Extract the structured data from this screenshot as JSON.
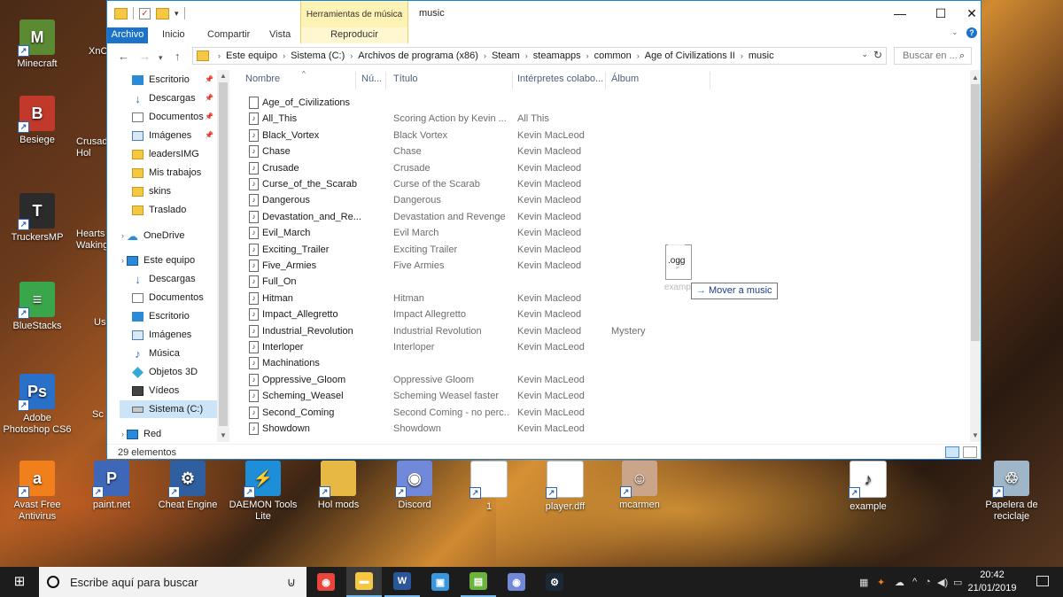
{
  "desktop": {
    "icons": [
      {
        "label": "Minecraft",
        "color": "#5b8a32",
        "glyph": "M"
      },
      {
        "label": "Besiege",
        "color": "#c0392b",
        "glyph": "B"
      },
      {
        "label": "TruckersMP",
        "color": "#2b2b2b",
        "glyph": "T"
      },
      {
        "label": "BlueStacks",
        "color": "#3aa64c",
        "glyph": "≡"
      },
      {
        "label": "Adobe Photoshop CS6",
        "color": "#2a6fc8",
        "glyph": "Ps"
      },
      {
        "label": "Avast Free Antivirus",
        "color": "#f07f1c",
        "glyph": "a"
      },
      {
        "label": "paint.net",
        "color": "#3e67b8",
        "glyph": "P"
      },
      {
        "label": "Cheat Engine",
        "color": "#2f5f9e",
        "glyph": "⚙"
      },
      {
        "label": "DAEMON Tools Lite",
        "color": "#1e8ed8",
        "glyph": "⚡"
      },
      {
        "label": "Hol mods",
        "color": "#e8b845",
        "glyph": ""
      },
      {
        "label": "Discord",
        "color": "#7289da",
        "glyph": "◉"
      },
      {
        "label": "1",
        "color": "#ffffff",
        "glyph": ""
      },
      {
        "label": "player.dff",
        "color": "#ffffff",
        "glyph": ""
      },
      {
        "label": "mcarmen",
        "color": "#caa58a",
        "glyph": "☺"
      },
      {
        "label": "example",
        "color": "#ffffff",
        "glyph": "♪"
      },
      {
        "label": "Papelera de reciclaje",
        "color": "#9fb5c8",
        "glyph": "♲"
      }
    ],
    "partial_labels": [
      "XnC",
      "Crusad Hol",
      "Hearts Waking",
      "Us",
      "Sc"
    ]
  },
  "window": {
    "title": "music",
    "context_tab_group": "Herramientas de música",
    "ribbon_tabs": [
      "Archivo",
      "Inicio",
      "Compartir",
      "Vista",
      "Reproducir"
    ],
    "accent_color": "#1a73c8"
  },
  "address": {
    "crumbs": [
      "Este equipo",
      "Sistema (C:)",
      "Archivos de programa (x86)",
      "Steam",
      "steamapps",
      "common",
      "Age of Civilizations II",
      "music"
    ],
    "search_placeholder": "Buscar en ..."
  },
  "navpane": {
    "quick_access": [
      {
        "label": "Escritorio",
        "icon": "desktop-icon",
        "pinned": true
      },
      {
        "label": "Descargas",
        "icon": "download-icon",
        "pinned": true
      },
      {
        "label": "Documentos",
        "icon": "document-icon",
        "pinned": true
      },
      {
        "label": "Imágenes",
        "icon": "image-icon",
        "pinned": true
      },
      {
        "label": "leadersIMG",
        "icon": "folder-icon",
        "pinned": false
      },
      {
        "label": "Mis trabajos",
        "icon": "folder-icon",
        "pinned": false
      },
      {
        "label": "skins",
        "icon": "folder-icon",
        "pinned": false
      },
      {
        "label": "Traslado",
        "icon": "folder-icon",
        "pinned": false
      }
    ],
    "onedrive": "OneDrive",
    "this_pc": "Este equipo",
    "pc_items": [
      {
        "label": "Descargas",
        "icon": "download-icon"
      },
      {
        "label": "Documentos",
        "icon": "document-icon"
      },
      {
        "label": "Escritorio",
        "icon": "desktop-icon"
      },
      {
        "label": "Imágenes",
        "icon": "image-icon"
      },
      {
        "label": "Música",
        "icon": "music-icon"
      },
      {
        "label": "Objetos 3D",
        "icon": "cube-icon"
      },
      {
        "label": "Vídeos",
        "icon": "video-icon"
      },
      {
        "label": "Sistema (C:)",
        "icon": "drive-icon",
        "selected": true
      }
    ],
    "network": "Red"
  },
  "columns": {
    "name": "Nombre",
    "number": "Nú...",
    "title": "Título",
    "artists": "Intérpretes colabo...",
    "album": "Álbum"
  },
  "files": [
    {
      "name": "Age_of_Civilizations",
      "title": "",
      "artist": "",
      "album": "",
      "type": "file"
    },
    {
      "name": "All_This",
      "title": "Scoring Action by Kevin ...",
      "artist": "All This",
      "album": "",
      "type": "music"
    },
    {
      "name": "Black_Vortex",
      "title": "Black Vortex",
      "artist": "Kevin MacLeod",
      "album": "",
      "type": "music"
    },
    {
      "name": "Chase",
      "title": "Chase",
      "artist": "Kevin Macleod",
      "album": "",
      "type": "music"
    },
    {
      "name": "Crusade",
      "title": "Crusade",
      "artist": "Kevin Macleod",
      "album": "",
      "type": "music"
    },
    {
      "name": "Curse_of_the_Scarab",
      "title": "Curse of the Scarab",
      "artist": "Kevin Macleod",
      "album": "",
      "type": "music"
    },
    {
      "name": "Dangerous",
      "title": "Dangerous",
      "artist": "Kevin Macleod",
      "album": "",
      "type": "music"
    },
    {
      "name": "Devastation_and_Re...",
      "title": "Devastation and Revenge",
      "artist": "Kevin Macleod",
      "album": "",
      "type": "music"
    },
    {
      "name": "Evil_March",
      "title": "Evil March",
      "artist": "Kevin Macleod",
      "album": "",
      "type": "music"
    },
    {
      "name": "Exciting_Trailer",
      "title": "Exciting Trailer",
      "artist": "Kevin Macleod",
      "album": "",
      "type": "music"
    },
    {
      "name": "Five_Armies",
      "title": "Five Armies",
      "artist": "Kevin Macleod",
      "album": "",
      "type": "music"
    },
    {
      "name": "Full_On",
      "title": "",
      "artist": "",
      "album": "",
      "type": "music"
    },
    {
      "name": "Hitman",
      "title": "Hitman",
      "artist": "Kevin Macleod",
      "album": "",
      "type": "music"
    },
    {
      "name": "Impact_Allegretto",
      "title": "Impact Allegretto",
      "artist": "Kevin Macleod",
      "album": "",
      "type": "music"
    },
    {
      "name": "Industrial_Revolution",
      "title": "Industrial Revolution",
      "artist": "Kevin Macleod",
      "album": "Mystery",
      "type": "music"
    },
    {
      "name": "Interloper",
      "title": "Interloper",
      "artist": "Kevin MacLeod",
      "album": "",
      "type": "music"
    },
    {
      "name": "Machinations",
      "title": "",
      "artist": "",
      "album": "",
      "type": "music"
    },
    {
      "name": "Oppressive_Gloom",
      "title": "Oppressive Gloom",
      "artist": "Kevin MacLeod",
      "album": "",
      "type": "music"
    },
    {
      "name": "Scheming_Weasel",
      "title": "Scheming Weasel faster",
      "artist": "Kevin MacLeod",
      "album": "",
      "type": "music"
    },
    {
      "name": "Second_Coming",
      "title": "Second Coming - no perc...",
      "artist": "Kevin MacLeod",
      "album": "",
      "type": "music"
    },
    {
      "name": "Showdown",
      "title": "Showdown",
      "artist": "Kevin MacLeod",
      "album": "",
      "type": "music"
    }
  ],
  "status": {
    "count": "29 elementos"
  },
  "drag": {
    "extension": ".ogg",
    "filename": "exampl",
    "tooltip": "Mover a music"
  },
  "taskbar": {
    "search_placeholder": "Escribe aquí para buscar",
    "apps": [
      {
        "name": "chrome",
        "color": "#e8453c",
        "glyph": "◉",
        "state": "none"
      },
      {
        "name": "file-explorer",
        "color": "#f4c842",
        "glyph": "▬",
        "state": "active"
      },
      {
        "name": "word",
        "color": "#2b579a",
        "glyph": "W",
        "state": "running"
      },
      {
        "name": "photos",
        "color": "#3a96dd",
        "glyph": "▣",
        "state": "none"
      },
      {
        "name": "notepad",
        "color": "#6bb33c",
        "glyph": "▤",
        "state": "running"
      },
      {
        "name": "discord",
        "color": "#7289da",
        "glyph": "◉",
        "state": "none"
      },
      {
        "name": "steam",
        "color": "#1b2838",
        "glyph": "⚙",
        "state": "none"
      }
    ],
    "time": "20:42",
    "date": "21/01/2019"
  }
}
